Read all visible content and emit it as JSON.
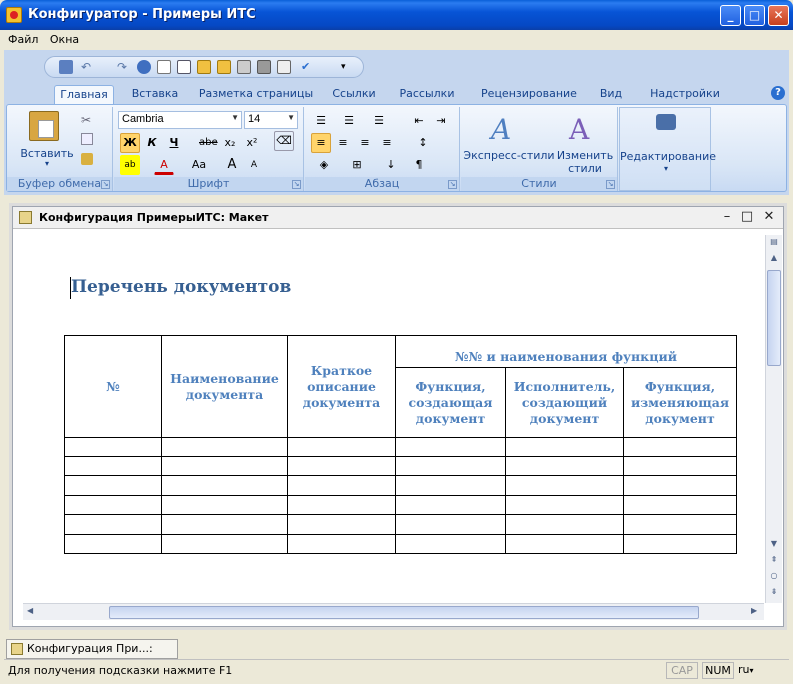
{
  "window": {
    "title": "Конфигуратор - Примеры ИТС"
  },
  "menu": [
    "Файл",
    "Окна"
  ],
  "ribbon": {
    "tabs": [
      "Главная",
      "Вставка",
      "Разметка страницы",
      "Ссылки",
      "Рассылки",
      "Рецензирование",
      "Вид",
      "Надстройки"
    ],
    "active_tab": "Главная",
    "clipboard": {
      "paste_label": "Вставить",
      "group_label": "Буфер обмена"
    },
    "font": {
      "name": "Cambria",
      "size": "14",
      "group_label": "Шрифт",
      "bold": "Ж",
      "italic": "К",
      "underline": "Ч",
      "strike": "abe",
      "subscript": "x₂",
      "superscript": "x²",
      "grow": "A",
      "shrink": "A",
      "case": "Aa"
    },
    "paragraph": {
      "group_label": "Абзац",
      "pilcrow": "¶"
    },
    "styles": {
      "quick_styles": "Экспресс-стили",
      "change_styles_1": "Изменить",
      "change_styles_2": "стили",
      "group_label": "Стили"
    },
    "editing": {
      "label": "Редактирование"
    }
  },
  "child_window": {
    "title": "Конфигурация ПримерыИТС: Макет"
  },
  "document": {
    "heading": "Перечень документов",
    "table": {
      "col_no": "№",
      "col_name": "Наименование документа",
      "col_desc": "Краткое описание документа",
      "group_header": "№№ и наименования  функций",
      "sub_creating": "Функция, создающая документ",
      "sub_executor": "Исполнитель, создающий документ",
      "sub_changing": "Функция, изменяющая документ",
      "empty_rows": 6
    }
  },
  "taskbar": {
    "tab_label": "Конфигурация При...: Макет"
  },
  "statusbar": {
    "hint": "Для получения подсказки нажмите F1",
    "cap": "CAP",
    "num": "NUM",
    "lang": "ru"
  },
  "colors": {
    "heading": "#365f91",
    "table_text": "#4f81bd",
    "title_bar": "#0754d6"
  }
}
